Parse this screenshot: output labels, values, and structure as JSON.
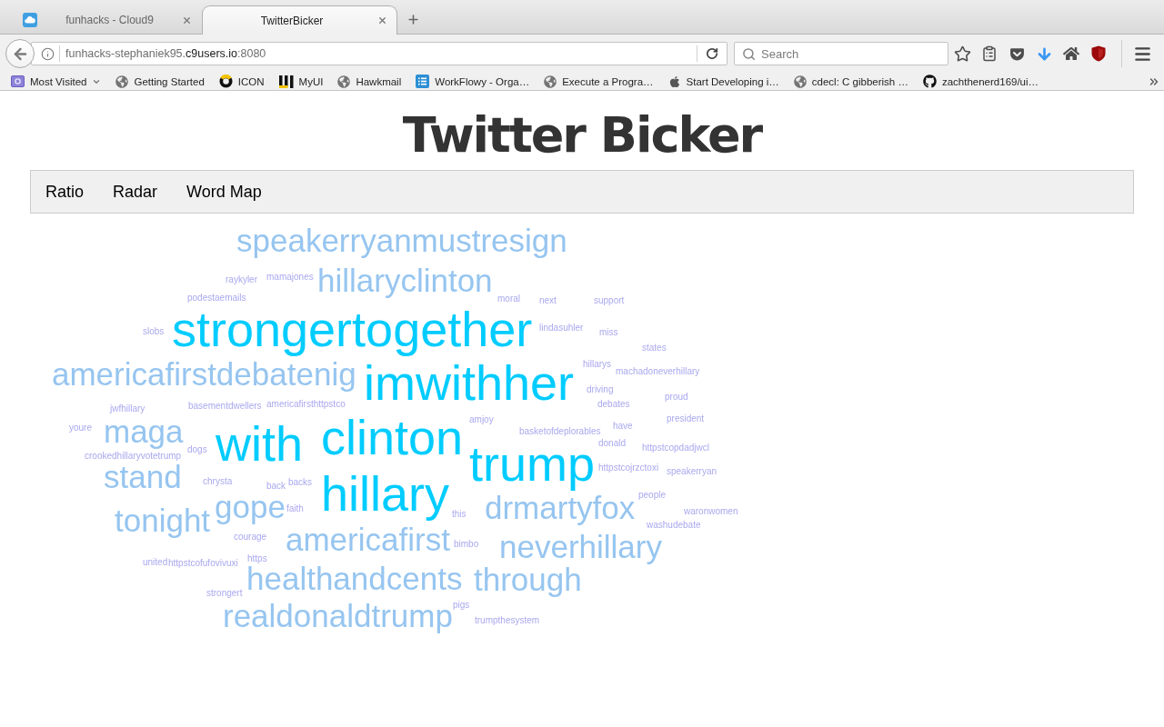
{
  "browser": {
    "tabs": [
      {
        "title": "funhacks - Cloud9",
        "selected": false
      },
      {
        "title": "TwitterBicker",
        "selected": true
      }
    ],
    "address": {
      "subdomain": "funhacks-stephaniek95.",
      "domain": "c9users.io",
      "port": ":8080"
    },
    "search": {
      "placeholder": "Search"
    },
    "bookmarks": [
      {
        "label": "Most Visited",
        "kind": "folder"
      },
      {
        "label": "Getting Started",
        "kind": "link"
      },
      {
        "label": "ICON",
        "kind": "link"
      },
      {
        "label": "MyUI",
        "kind": "link"
      },
      {
        "label": "Hawkmail",
        "kind": "link"
      },
      {
        "label": "WorkFlowy - Orga…",
        "kind": "link"
      },
      {
        "label": "Execute a Progra…",
        "kind": "link"
      },
      {
        "label": "Start Developing i…",
        "kind": "link"
      },
      {
        "label": "cdecl: C gibberish …",
        "kind": "link"
      },
      {
        "label": "zachthenerd169/ui…",
        "kind": "link"
      }
    ]
  },
  "page": {
    "title": "Twitter Bicker",
    "nav": [
      {
        "label": "Ratio",
        "selected": false
      },
      {
        "label": "Radar",
        "selected": false
      },
      {
        "label": "Word Map",
        "selected": false
      }
    ],
    "word_map": {
      "words": [
        {
          "text": "speakerryanmustresign",
          "kind": "medium",
          "color": "#96c5f0"
        },
        {
          "text": "raykyler",
          "kind": "small",
          "color": "#a9a8ee"
        },
        {
          "text": "mamajones",
          "kind": "small",
          "color": "#a9a8ee"
        },
        {
          "text": "podestaemails",
          "kind": "small",
          "color": "#a9a8ee"
        },
        {
          "text": "hillaryclinton",
          "kind": "medium",
          "color": "#96c5f0"
        },
        {
          "text": "moral",
          "kind": "small",
          "color": "#a9a8ee"
        },
        {
          "text": "next",
          "kind": "small",
          "color": "#a9a8ee"
        },
        {
          "text": "support",
          "kind": "small",
          "color": "#a9a8ee"
        },
        {
          "text": "slobs",
          "kind": "small",
          "color": "#a9a8ee"
        },
        {
          "text": "strongertogether",
          "kind": "large",
          "color": "#00ccff"
        },
        {
          "text": "lindasuhler",
          "kind": "small",
          "color": "#a9a8ee"
        },
        {
          "text": "miss",
          "kind": "small",
          "color": "#a9a8ee"
        },
        {
          "text": "states",
          "kind": "small",
          "color": "#a9a8ee"
        },
        {
          "text": "americafirstdebatenig",
          "kind": "medium",
          "color": "#96c5f0"
        },
        {
          "text": "jwfhillary",
          "kind": "small",
          "color": "#a9a8ee"
        },
        {
          "text": "basementdwellers",
          "kind": "small",
          "color": "#a9a8ee"
        },
        {
          "text": "americafirsthttpstco",
          "kind": "small",
          "color": "#a9a8ee"
        },
        {
          "text": "imwithher",
          "kind": "large",
          "color": "#00ccff"
        },
        {
          "text": "hillarys",
          "kind": "small",
          "color": "#a9a8ee"
        },
        {
          "text": "machadoneverhillary",
          "kind": "small",
          "color": "#a9a8ee"
        },
        {
          "text": "driving",
          "kind": "small",
          "color": "#a9a8ee"
        },
        {
          "text": "debates",
          "kind": "small",
          "color": "#a9a8ee"
        },
        {
          "text": "proud",
          "kind": "small",
          "color": "#a9a8ee"
        },
        {
          "text": "youre",
          "kind": "small",
          "color": "#a9a8ee"
        },
        {
          "text": "maga",
          "kind": "medium",
          "color": "#96c5f0"
        },
        {
          "text": "crookedhillaryvotetrump",
          "kind": "small",
          "color": "#a9a8ee"
        },
        {
          "text": "dogs",
          "kind": "small",
          "color": "#a9a8ee"
        },
        {
          "text": "with",
          "kind": "large",
          "color": "#00ccff"
        },
        {
          "text": "clinton",
          "kind": "large",
          "color": "#00ccff"
        },
        {
          "text": "amjoy",
          "kind": "small",
          "color": "#a9a8ee"
        },
        {
          "text": "basketofdeplorables",
          "kind": "small",
          "color": "#a9a8ee"
        },
        {
          "text": "have",
          "kind": "small",
          "color": "#a9a8ee"
        },
        {
          "text": "president",
          "kind": "small",
          "color": "#a9a8ee"
        },
        {
          "text": "trump",
          "kind": "large",
          "color": "#00ccff"
        },
        {
          "text": "donald",
          "kind": "small",
          "color": "#a9a8ee"
        },
        {
          "text": "httpstcopdadjwcl",
          "kind": "small",
          "color": "#a9a8ee"
        },
        {
          "text": "stand",
          "kind": "medium",
          "color": "#96c5f0"
        },
        {
          "text": "chrysta",
          "kind": "small",
          "color": "#a9a8ee"
        },
        {
          "text": "back",
          "kind": "small",
          "color": "#a9a8ee"
        },
        {
          "text": "backs",
          "kind": "small",
          "color": "#a9a8ee"
        },
        {
          "text": "hillary",
          "kind": "large",
          "color": "#00ccff"
        },
        {
          "text": "httpstcojrzctoxi",
          "kind": "small",
          "color": "#a9a8ee"
        },
        {
          "text": "speakerryan",
          "kind": "small",
          "color": "#a9a8ee"
        },
        {
          "text": "tonight",
          "kind": "medium",
          "color": "#96c5f0"
        },
        {
          "text": "gope",
          "kind": "medium",
          "color": "#96c5f0"
        },
        {
          "text": "faith",
          "kind": "small",
          "color": "#a9a8ee"
        },
        {
          "text": "this",
          "kind": "small",
          "color": "#a9a8ee"
        },
        {
          "text": "drmartyfox",
          "kind": "medium",
          "color": "#96c5f0"
        },
        {
          "text": "people",
          "kind": "small",
          "color": "#a9a8ee"
        },
        {
          "text": "waronwomen",
          "kind": "small",
          "color": "#a9a8ee"
        },
        {
          "text": "courage",
          "kind": "small",
          "color": "#a9a8ee"
        },
        {
          "text": "americafirst",
          "kind": "medium",
          "color": "#96c5f0"
        },
        {
          "text": "bimbo",
          "kind": "small",
          "color": "#a9a8ee"
        },
        {
          "text": "neverhillary",
          "kind": "medium",
          "color": "#96c5f0"
        },
        {
          "text": "washudebate",
          "kind": "small",
          "color": "#a9a8ee"
        },
        {
          "text": "united",
          "kind": "small",
          "color": "#a9a8ee"
        },
        {
          "text": "httpstcofufovivuxi",
          "kind": "small",
          "color": "#a9a8ee"
        },
        {
          "text": "https",
          "kind": "small",
          "color": "#a9a8ee"
        },
        {
          "text": "strongert",
          "kind": "small",
          "color": "#a9a8ee"
        },
        {
          "text": "healthandcents",
          "kind": "medium",
          "color": "#96c5f0"
        },
        {
          "text": "through",
          "kind": "medium",
          "color": "#96c5f0"
        },
        {
          "text": "realdonaldtrump",
          "kind": "medium",
          "color": "#96c5f0"
        },
        {
          "text": "pigs",
          "kind": "small",
          "color": "#a9a8ee"
        },
        {
          "text": "trumpthesystem",
          "kind": "small",
          "color": "#a9a8ee"
        }
      ]
    }
  }
}
